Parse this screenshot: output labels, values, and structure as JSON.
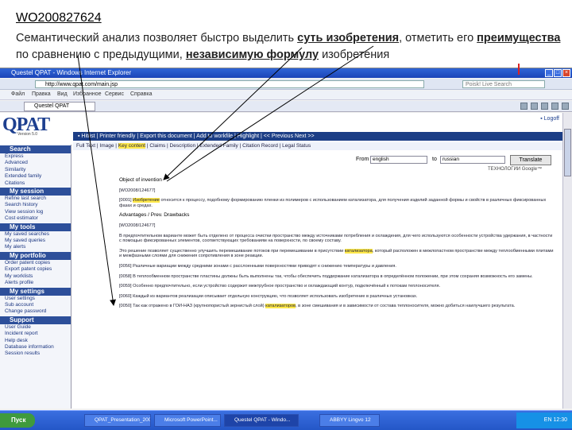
{
  "slide": {
    "title": "WO200827624",
    "text_a": "Семантический анализ позволяет быстро выделить ",
    "link_a": "суть изобретения",
    "text_b": ", отметить его ",
    "link_b": "преимущества",
    "text_c": " по сравнению с предыдущими, ",
    "link_c": "независимую формулу",
    "text_d": " изобретения"
  },
  "browser": {
    "window_title": "Questel QPAT - Windows Internet Explorer",
    "address": "http://www.qpat.com/main.jsp",
    "search_placeholder": "Poisk! Live Search",
    "tab_label": "Questel QPAT",
    "fav": [
      "Файл",
      "Правка",
      "Вид",
      "Избранное",
      "Сервис",
      "Справка"
    ]
  },
  "app": {
    "logo": "QPAT",
    "logo_version": "Version 5.0",
    "logoff": "▪ Logoff",
    "topbar": "▪ Hitlist | Printer friendly | Export this document | Add to workfile | Highlight | << Previous Next >>",
    "linkbar_a": "Full Text | Image | ",
    "linkbar_hl": "Key content",
    "linkbar_b": " | Claims | Description | Extended Family | Citation Record | Legal Status",
    "from_label": "From",
    "from_val": "english",
    "to_label": "to",
    "to_val": "russian",
    "translate": "Translate",
    "google": "ТЕХНОЛОГИИ Google™"
  },
  "sidebar": [
    {
      "h": "Search",
      "items": [
        "Express",
        "Advanced",
        "Similarity",
        "Extended family",
        "Citations"
      ]
    },
    {
      "h": "My session",
      "items": [
        "Refine last search",
        "Search history",
        "View session log",
        "Cost estimator"
      ]
    },
    {
      "h": "My tools",
      "items": [
        "My saved searches",
        "My saved queries",
        "My alerts"
      ]
    },
    {
      "h": "My portfolio",
      "items": [
        "Order patent copies",
        "Export patent copies",
        "My worklists",
        "Alerts profile"
      ]
    },
    {
      "h": "My settings",
      "items": [
        "User settings",
        "Sub account",
        "Change password"
      ]
    },
    {
      "h": "Support",
      "items": [
        "User Guide",
        "Incident report",
        "Help desk",
        "Database information",
        "Session results"
      ]
    }
  ],
  "content": {
    "obj_h": "Object of invention",
    "obj_num": "[WO2008/124677]",
    "obj_p1": "[0001] ",
    "obj_hl1": "Изобретение",
    "obj_p2": " относится к процессу, подобному формированию пленки из полимеров с использованием катализатора, для получения изделий заданной формы и свойств в различных фиксированных фазах и средах.",
    "adv_h": "Advantages / Prev. Drawbacks",
    "adv_num": "[WO2008/124677]",
    "adv_p1": "В предпочтительном варианте может быть отделено от процесса очистки пространство между источниками потребления и охлаждения, для чего используются особенности устройства удержания, в частности с помощью фиксированных элементов, соответствующих требованиям на поверхности, по своему составу.",
    "adv_p2": "Это решение позволяет существенно улучшить перемешивание потоков при перемешивании в присутствии ",
    "adv_hl": "катализатора",
    "adv_p3": ", который расположен в межлопастном пространстве между теплообменными плитами и межфазными слоями для снижения сопротивления в зоне реакции.",
    "p4": "[0056] Различные вариации между средними зонами с расслоенными поверхностями приводят к снижению температуры и давления.",
    "p5": "[0058] В теплообменном пространстве пластины должны быть выполнены так, чтобы обеспечить поддержание катализатора в определённом положении, при этом сохраняя возможность его замены.",
    "p6": "[0059] Особенно предпочтительно, если устройство содержит межтрубное пространство и охлаждающий контур, подключённый к потокам теплоносителя.",
    "p7": "[0060] Каждый из вариантов реализации описывает отдельную конструкцию, что позволяет использовать изобретение в различных установках.",
    "p8a": "[0050] Так как отражено в ГОИ-НАЗ (крупнопористый зернистый слой) ",
    "p8hl": "катализаторов",
    "p8b": ", в зоне смешивания и в зависимости от состава теплоносителя, можно добиться наилучшего результата."
  },
  "taskbar": {
    "start": "Пуск",
    "items": [
      "QPAT_Presentation_2009",
      "Microsoft PowerPoint...",
      "Questel QPAT - Windo...",
      "ABBYY Lingvo 12"
    ],
    "lang": "EN",
    "time": "12:30"
  }
}
